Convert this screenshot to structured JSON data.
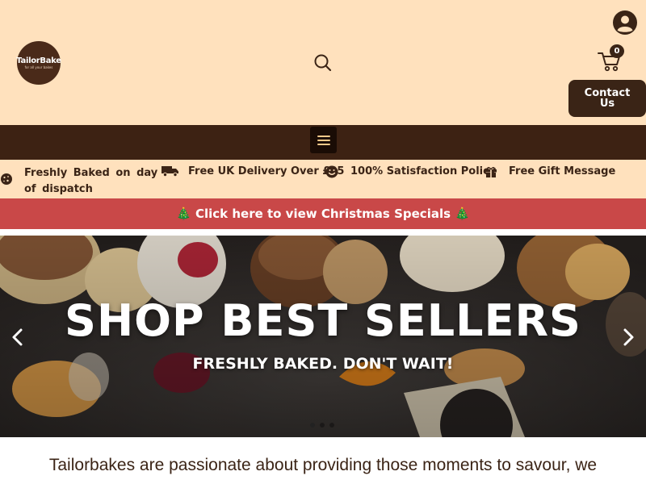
{
  "header": {
    "logo": {
      "name": "TailorBake",
      "tagline": "for all your bakes"
    },
    "cart_count": "0",
    "contact_label": "Contact Us"
  },
  "features": [
    {
      "icon": "cookie-icon",
      "text": "Freshly Baked on day of dispatch"
    },
    {
      "icon": "truck-icon",
      "text": "Free UK Delivery Over £35"
    },
    {
      "icon": "smile-icon",
      "text": "100% Satisfaction Policy"
    },
    {
      "icon": "gift-icon",
      "text": "Free Gift Message"
    }
  ],
  "promo": {
    "text": "🎄 Click here to view Christmas Specials 🎄"
  },
  "hero": {
    "title": "SHOP BEST SELLERS",
    "subtitle": "FRESHLY BAKED. DON'T WAIT!",
    "slide_count": 3,
    "active_slide": 1
  },
  "intro": {
    "text": "Tailorbakes are passionate about providing those moments to savour, we"
  },
  "colors": {
    "header_bg": "#ffe1bd",
    "nav_bg": "#3d2213",
    "promo_bg": "#c94848",
    "dark_brown": "#3a2416"
  }
}
